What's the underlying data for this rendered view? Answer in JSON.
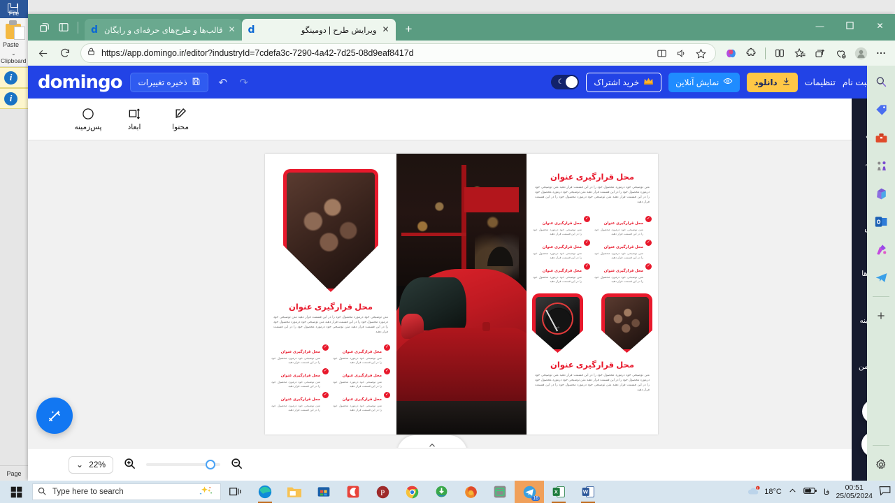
{
  "word_bg": {
    "file_label": "File",
    "paste_label": "Paste",
    "clipboard_label": "Clipboard",
    "page_label": "Page"
  },
  "browser": {
    "tabs": [
      {
        "title": "قالب‌ها و طرح‌های حرفه‌ای و رایگان",
        "favicon": "d",
        "active": false,
        "close": "✕"
      },
      {
        "title": "ویرایش طرح | دومینگو",
        "favicon": "d",
        "active": true,
        "close": "✕"
      }
    ],
    "new_tab": "+",
    "window_buttons": {
      "minimize": "—",
      "maximize": "▢",
      "close": "✕"
    },
    "url": "https://app.domingo.ir/editor?industryId=7cdefa3c-7290-4a42-7d25-08d9eaf8417d",
    "url_bold": "app.domingo.ir"
  },
  "app": {
    "logo": "domingo",
    "save_label": "ذخیره تغییرات",
    "login_label": "ورود/ثبت نام",
    "settings_label": "تنظیمات",
    "download_label": "دانلود",
    "online_preview_label": "نمایش آنلاین",
    "subscription_label": "خرید اشتراک",
    "accent_blue": "#2243e6",
    "accent_yellow": "#ffc746",
    "accent_lightblue": "#1f8cff",
    "tools": [
      {
        "label": "پس‌زمینه",
        "icon": "circle-icon"
      },
      {
        "label": "ابعاد",
        "icon": "resize-icon"
      },
      {
        "label": "محتوا",
        "icon": "pencil-icon"
      }
    ],
    "sidebar": [
      {
        "label": "قالب",
        "icon": "template-icon"
      },
      {
        "label": "متن",
        "icon": "text-icon"
      },
      {
        "label": "عکس",
        "icon": "image-icon"
      },
      {
        "label": "آیکون‌ها",
        "icon": "grid-icon"
      },
      {
        "label": "پس‌زمینه",
        "icon": "background-icon"
      },
      {
        "label": "فضای من",
        "icon": "cloud-upload-icon"
      },
      {
        "label": "اشکال",
        "icon": "shapes-icon"
      }
    ],
    "zoom": {
      "value": "22%",
      "chevron": "⌄",
      "zoom_in": "zoom-in-icon",
      "zoom_out": "zoom-out-icon"
    }
  },
  "design": {
    "heading": "محل قرارگیری عنوان",
    "paragraph": "متن توضیحی خود درمورد محصول خود را در این قسمت قرار دهید متن توضیحی خود درمورد محصول خود را در این قسمت قرار دهید متن توضیحی خود درمورد محصول خود را در این قسمت قرار دهید متن توضیحی خود درمورد محصول خود را در این قسمت قرار دهید",
    "bullet_title": "محل قرارگیری عنوان",
    "bullet_text": "متن توضیحی خود درمورد محصول خود را در این قسمت قرار دهید",
    "check_glyph": "✓",
    "bullets_count": 6,
    "heading_color": "#e8192c"
  },
  "taskbar": {
    "search_placeholder": "Type here to search",
    "temperature": "18°C",
    "language": "فا",
    "time": "00:51",
    "date": "25/05/2024",
    "telegram_badge": "16",
    "apps": [
      {
        "name": "file-explorer"
      },
      {
        "name": "microsoft-store"
      },
      {
        "name": "camtasia"
      },
      {
        "name": "potplayer"
      },
      {
        "name": "google-chrome"
      },
      {
        "name": "internet-download-manager"
      },
      {
        "name": "mozilla-firefox"
      },
      {
        "name": "notes-app"
      },
      {
        "name": "telegram"
      },
      {
        "name": "microsoft-excel"
      },
      {
        "name": "microsoft-word"
      }
    ]
  }
}
